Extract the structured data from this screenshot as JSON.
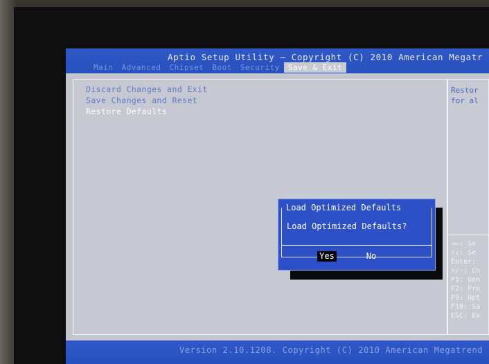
{
  "screen": {
    "title": "Aptio Setup Utility – Copyright (C) 2010 American Megatr",
    "tabs": [
      "Main",
      "Advanced",
      "Chipset",
      "Boot",
      "Security",
      "Save & Exit"
    ],
    "active_tab": "Save & Exit",
    "menu_items": [
      "Discard Changes and Exit",
      "Save Changes and Reset",
      "Restore Defaults"
    ],
    "selected_menu_item": "Restore Defaults",
    "help_text": "Restor\nfor al",
    "key_help": [
      "→←: Se",
      "↑↓: Se",
      "Enter:",
      "+/-: Ch",
      "F1: Gen",
      "F2: Pre",
      "F9: Opt",
      "F10: Sa",
      "ESC: Ex"
    ],
    "footer": "Version 2.10.1208. Copyright (C) 2010 American Megatrend"
  },
  "dialog": {
    "title": "Load Optimized Defaults",
    "question": "Load Optimized Defaults?",
    "yes_label": "Yes",
    "no_label": "No",
    "selected_button": "Yes"
  },
  "colors": {
    "bios_blue": "#2751bd",
    "panel_gray": "#c3c5cf",
    "selected_text": "#ffffff",
    "yes_highlight": "#040404",
    "status_led": "#9ed334"
  },
  "icons": {
    "status_led": "green-status-light"
  }
}
